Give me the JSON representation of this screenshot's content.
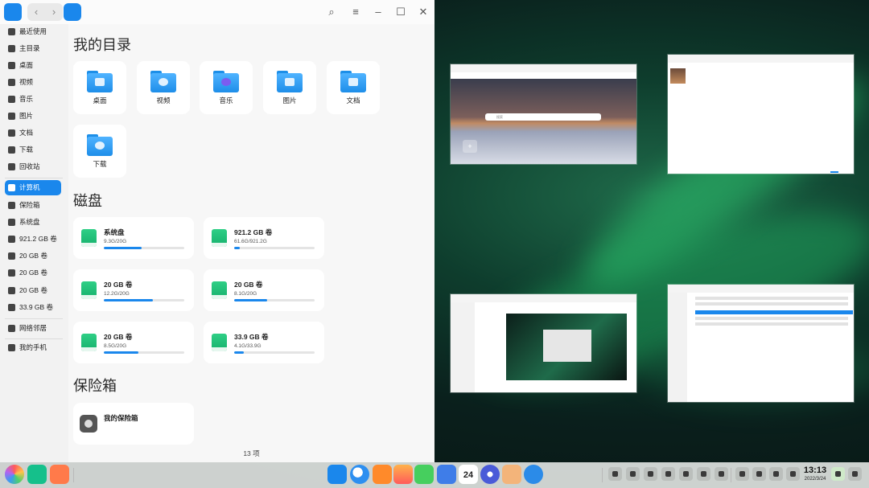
{
  "file_manager": {
    "sidebar": {
      "items": [
        {
          "label": "最近使用",
          "icon": "clock-icon"
        },
        {
          "label": "主目录",
          "icon": "home-icon"
        },
        {
          "label": "桌面",
          "icon": "desktop-icon"
        },
        {
          "label": "视频",
          "icon": "video-icon"
        },
        {
          "label": "音乐",
          "icon": "music-icon"
        },
        {
          "label": "图片",
          "icon": "picture-icon"
        },
        {
          "label": "文档",
          "icon": "document-icon"
        },
        {
          "label": "下载",
          "icon": "download-icon"
        },
        {
          "label": "回收站",
          "icon": "trash-icon"
        },
        {
          "label": "计算机",
          "icon": "computer-icon",
          "active": true
        },
        {
          "label": "保险箱",
          "icon": "vault-icon"
        },
        {
          "label": "系统盘",
          "icon": "disk-icon"
        },
        {
          "label": "921.2 GB 卷",
          "icon": "disk-icon"
        },
        {
          "label": "20 GB 卷",
          "icon": "disk-icon"
        },
        {
          "label": "20 GB 卷",
          "icon": "disk-icon"
        },
        {
          "label": "20 GB 卷",
          "icon": "disk-icon"
        },
        {
          "label": "33.9 GB 卷",
          "icon": "disk-icon"
        },
        {
          "label": "网络邻居",
          "icon": "network-icon"
        },
        {
          "label": "我的手机",
          "icon": "phone-icon"
        }
      ]
    },
    "sections": {
      "my_directory": "我的目录",
      "disks": "磁盘",
      "vault": "保险箱"
    },
    "folders": [
      "桌面",
      "视频",
      "音乐",
      "图片",
      "文档",
      "下载"
    ],
    "disks": [
      {
        "name": "系统盘",
        "usage": "9.3G/20G",
        "used_fraction": 0.465
      },
      {
        "name": "921.2 GB 卷",
        "usage": "61.6G/921.2G",
        "used_fraction": 0.067
      },
      {
        "name": "20 GB 卷",
        "usage": "12.2G/20G",
        "used_fraction": 0.61
      },
      {
        "name": "20 GB 卷",
        "usage": "8.1G/20G",
        "used_fraction": 0.405
      },
      {
        "name": "20 GB 卷",
        "usage": "8.5G/20G",
        "used_fraction": 0.425
      },
      {
        "name": "33.9 GB 卷",
        "usage": "4.1G/33.9G",
        "used_fraction": 0.121
      }
    ],
    "vault_item": "我的保险箱",
    "status": "13 项"
  },
  "thumbnails": {
    "browser_search_placeholder": "搜索"
  },
  "dock": {
    "time": "13:13",
    "date": "2022/3/24",
    "calendar_day": "24"
  },
  "colors": {
    "accent": "#1a87ec",
    "disk_green": "#16b06c"
  }
}
